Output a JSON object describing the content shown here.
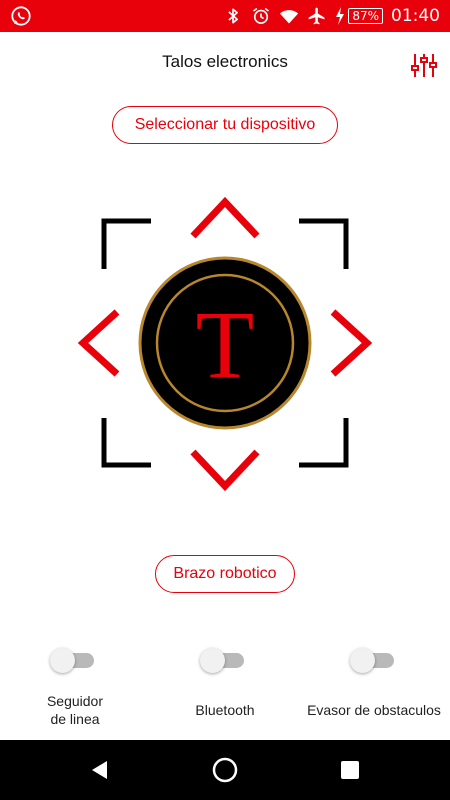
{
  "status_bar": {
    "battery_percent": "87%",
    "time": "01:40",
    "icons": [
      "whatsapp-icon",
      "bluetooth-icon",
      "alarm-icon",
      "wifi-icon",
      "airplane-icon",
      "charging-icon",
      "battery-icon"
    ]
  },
  "header": {
    "title": "Talos electronics",
    "settings_icon": "sliders-icon"
  },
  "buttons": {
    "select_device": "Seleccionar tu dispositivo",
    "robot_arm": "Brazo robotico"
  },
  "controller": {
    "center_letter": "T",
    "directions": [
      "up",
      "down",
      "left",
      "right"
    ],
    "colors": {
      "arrow": "#e8000b",
      "corner": "#000000",
      "ring": "#b8862d",
      "letter": "#e8000b",
      "disc": "#000000"
    }
  },
  "toggles": [
    {
      "label": "Seguidor\nde linea",
      "on": false
    },
    {
      "label": "Bluetooth",
      "on": false
    },
    {
      "label": "Evasor de obstaculos",
      "on": false
    }
  ],
  "nav_bar": {
    "icons": [
      "back-icon",
      "home-icon",
      "recents-icon"
    ]
  },
  "theme": {
    "accent": "#e8000b"
  }
}
